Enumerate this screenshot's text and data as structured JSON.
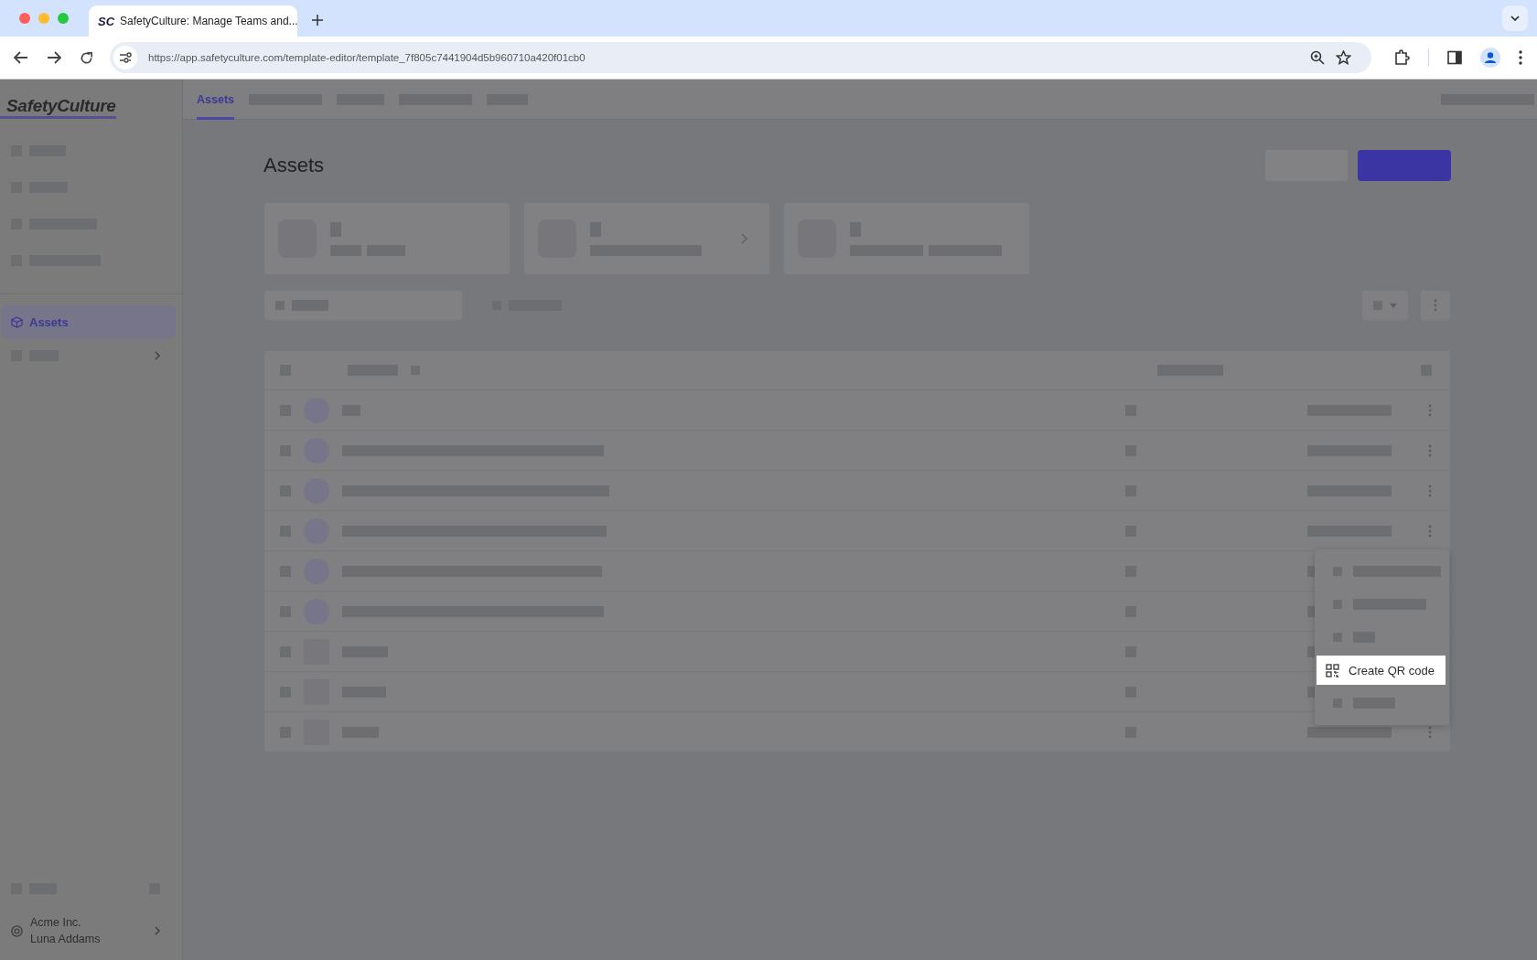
{
  "browser": {
    "tab_icon": "SC",
    "tab_title": "SafetyCulture: Manage Teams and...",
    "url": "https://app.safetyculture.com/template-editor/template_7f805c7441904d5b960710a420f01cb0"
  },
  "sidebar": {
    "logo": "SafetyCulture",
    "items": [
      {
        "label": "Assets",
        "selected": true
      }
    ],
    "org": "Acme Inc.",
    "user": "Luna Addams"
  },
  "tabs": [
    {
      "label": "Assets",
      "selected": true
    }
  ],
  "page_title": "Assets",
  "menu": {
    "items": [
      {
        "label": "Create QR code",
        "selected": true
      }
    ]
  }
}
